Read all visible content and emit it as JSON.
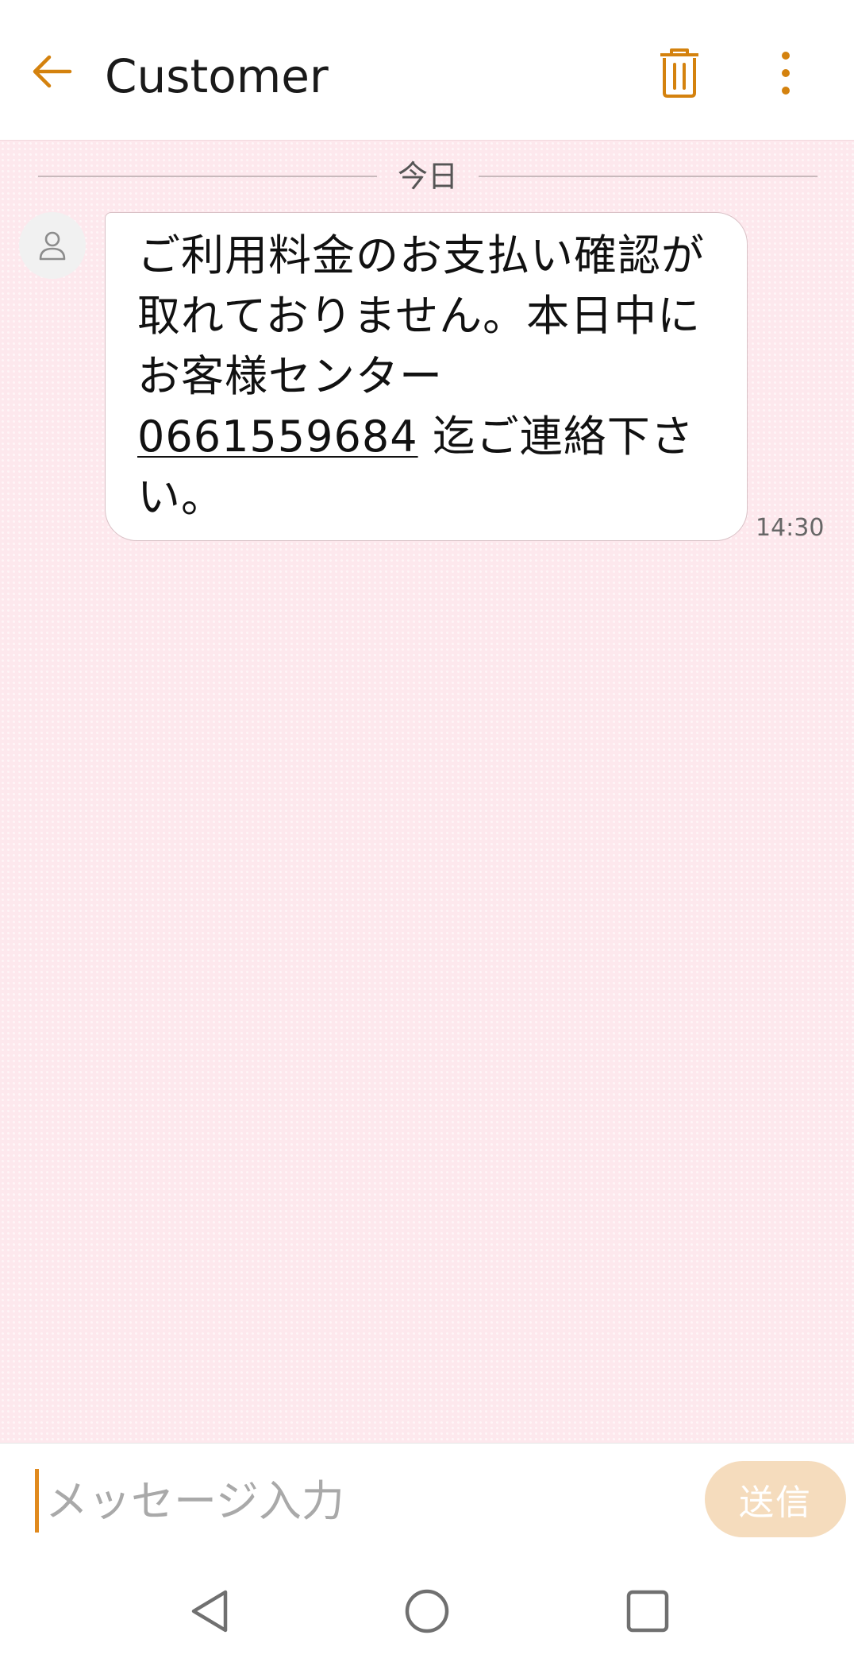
{
  "header": {
    "title": "Customer",
    "back_icon": "arrow-left-icon",
    "delete_icon": "trash-icon",
    "more_icon": "more-vertical-icon"
  },
  "conversation": {
    "date_label": "今日",
    "message": {
      "text_before_link": "ご利用料金のお支払い確認が取れておりません。本日中にお客様センター",
      "phone_number": "0661559684",
      "text_after_link": " 迄ご連絡下さい。",
      "time": "14:30"
    }
  },
  "composer": {
    "placeholder": "メッセージ入力",
    "value": "",
    "send_label": "送信"
  },
  "colors": {
    "accent": "#d4820e",
    "background": "#fde8ed",
    "send_button": "#f5dcbd"
  },
  "nav": {
    "back_icon": "triangle-back-icon",
    "home_icon": "circle-home-icon",
    "recents_icon": "square-recents-icon"
  }
}
